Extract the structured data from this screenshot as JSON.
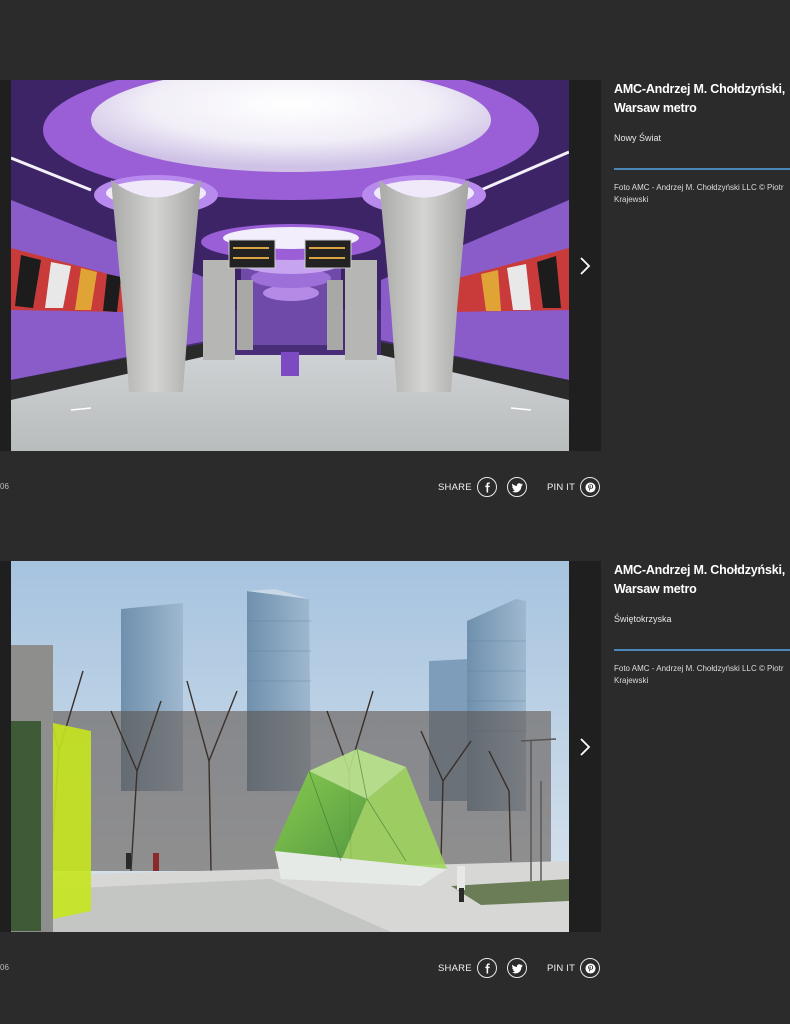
{
  "gallery": [
    {
      "title": "AMC-Andrzej M. Chołdzyński, Warsaw metro",
      "subtitle": "Nowy Świat",
      "credit": "Foto AMC - Andrzej M. Chołdzyński LLC © Piotr Krajewski",
      "counter": "06",
      "share_label": "SHARE",
      "pin_label": "PIN IT",
      "icons": {
        "facebook": "facebook-icon",
        "twitter": "twitter-icon",
        "pinterest": "pinterest-icon",
        "next": "chevron-right-icon"
      }
    },
    {
      "title": "AMC-Andrzej M. Chołdzyński, Warsaw metro",
      "subtitle": "Świętokrzyska",
      "credit": "Foto AMC - Andrzej M. Chołdzyński LLC © Piotr Krajewski",
      "counter": "06",
      "share_label": "SHARE",
      "pin_label": "PIN IT",
      "icons": {
        "facebook": "facebook-icon",
        "twitter": "twitter-icon",
        "pinterest": "pinterest-icon",
        "next": "chevron-right-icon"
      }
    }
  ],
  "colors": {
    "background": "#2b2b2b",
    "divider": "#4a86b8",
    "metro_purple": "#8a5cc9"
  }
}
